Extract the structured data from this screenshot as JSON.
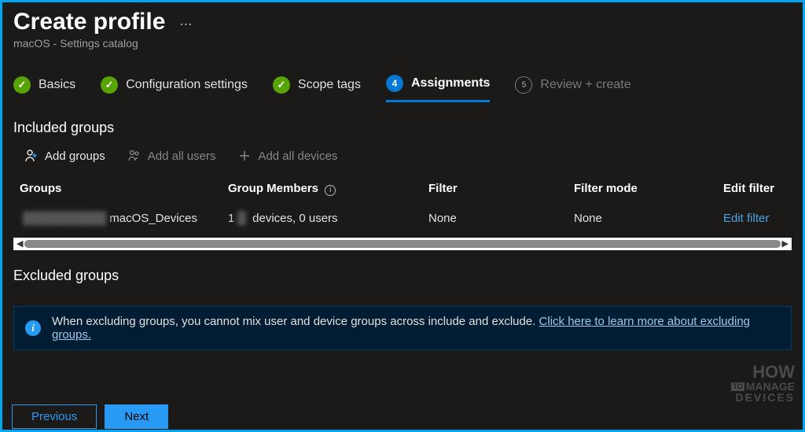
{
  "header": {
    "title": "Create profile",
    "subtitle": "macOS - Settings catalog"
  },
  "tabs": [
    {
      "label": "Basics",
      "state": "done"
    },
    {
      "label": "Configuration settings",
      "state": "done"
    },
    {
      "label": "Scope tags",
      "state": "done"
    },
    {
      "label": "Assignments",
      "state": "active",
      "num": "4"
    },
    {
      "label": "Review + create",
      "state": "pending",
      "num": "5"
    }
  ],
  "included": {
    "title": "Included groups",
    "actions": {
      "add_groups": "Add groups",
      "add_all_users": "Add all users",
      "add_all_devices": "Add all devices"
    },
    "columns": {
      "groups": "Groups",
      "group_members": "Group Members",
      "filter": "Filter",
      "filter_mode": "Filter mode",
      "edit_filter": "Edit filter"
    },
    "rows": [
      {
        "group_prefix_hidden": "██████████",
        "group_suffix": "macOS_Devices",
        "members_prefix": "1",
        "members_suffix": "devices, 0 users",
        "filter": "None",
        "filter_mode": "None",
        "edit_filter": "Edit filter"
      }
    ]
  },
  "excluded": {
    "title": "Excluded groups",
    "banner_text": "When excluding groups, you cannot mix user and device groups across include and exclude. ",
    "banner_link": "Click here to learn more about excluding groups."
  },
  "footer": {
    "previous": "Previous",
    "next": "Next"
  },
  "watermark": {
    "line1": "HOW",
    "line2a": "TO",
    "line2b": "MANAGE",
    "line3": "DEVICES"
  }
}
